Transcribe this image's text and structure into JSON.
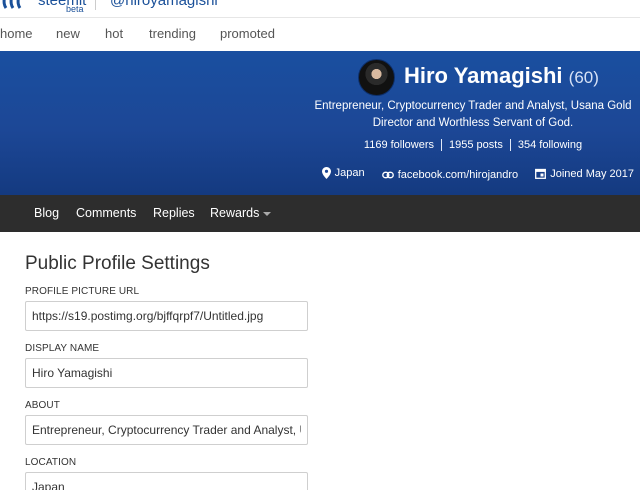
{
  "header": {
    "brand": "steemit",
    "beta": "beta",
    "handle": "@hiroyamagishi"
  },
  "nav": {
    "items": [
      "home",
      "new",
      "hot",
      "trending",
      "promoted"
    ]
  },
  "profile": {
    "name": "Hiro Yamagishi",
    "reputation": "(60)",
    "about": "Entrepreneur, Cryptocurrency Trader and Analyst, Usana Gold Director and Worthless Servant of God.",
    "followers": "1169 followers",
    "posts": "1955 posts",
    "following": "354 following",
    "location": "Japan",
    "website": "facebook.com/hirojandro",
    "joined": "Joined May 2017"
  },
  "tabs": {
    "blog": "Blog",
    "comments": "Comments",
    "replies": "Replies",
    "rewards": "Rewards"
  },
  "settings": {
    "title": "Public Profile Settings",
    "picture_label": "PROFILE PICTURE URL",
    "picture_value": "https://s19.postimg.org/bjffqrpf7/Untitled.jpg",
    "name_label": "DISPLAY NAME",
    "name_value": "Hiro Yamagishi",
    "about_label": "ABOUT",
    "about_value": "Entrepreneur, Cryptocurrency Trader and Analyst, Usana Gold Director and Worthless Servant of God.",
    "location_label": "LOCATION",
    "location_value": "Japan"
  },
  "colors": {
    "banner": "#1c4796",
    "tabbar": "#2d2d2d",
    "link": "#1a5099"
  }
}
